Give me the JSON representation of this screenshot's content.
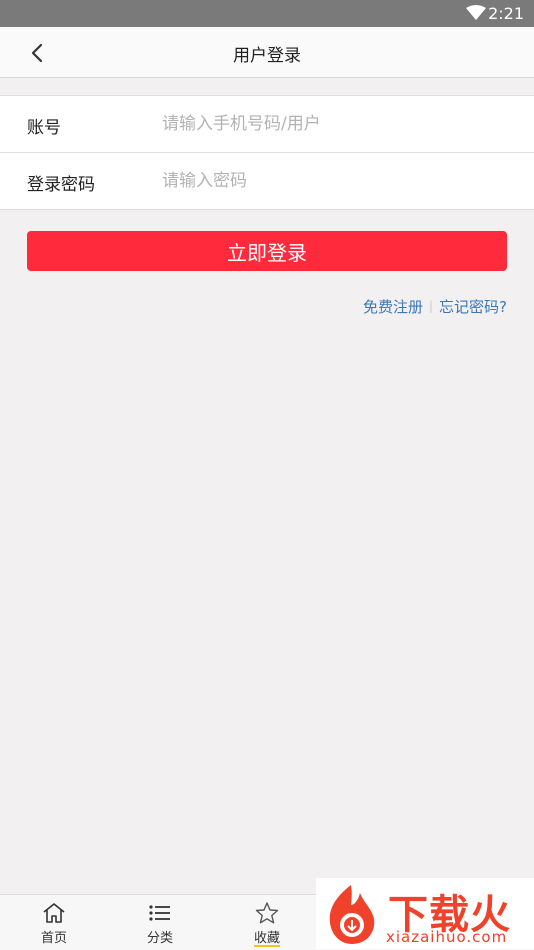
{
  "status_bar": {
    "time": "2:21",
    "wifi_icon": "wifi-icon"
  },
  "header": {
    "title": "用户登录",
    "back_icon": "chevron-left-icon"
  },
  "form": {
    "account_label": "账号",
    "account_placeholder": "请输入手机号码/用户",
    "password_label": "登录密码",
    "password_placeholder": "请输入密码"
  },
  "login_button": "立即登录",
  "links": {
    "register": "免费注册",
    "forgot_password": "忘记密码?"
  },
  "tabbar": {
    "items": [
      {
        "label": "首页",
        "icon": "home-icon"
      },
      {
        "label": "分类",
        "icon": "list-icon"
      },
      {
        "label": "收藏",
        "icon": "star-icon"
      }
    ]
  },
  "watermark": {
    "brand": "下载火",
    "url": "xiazaihuo.com"
  },
  "colors": {
    "accent": "#ff2a3c",
    "link": "#3a78b8",
    "background": "#f2f0f1"
  }
}
